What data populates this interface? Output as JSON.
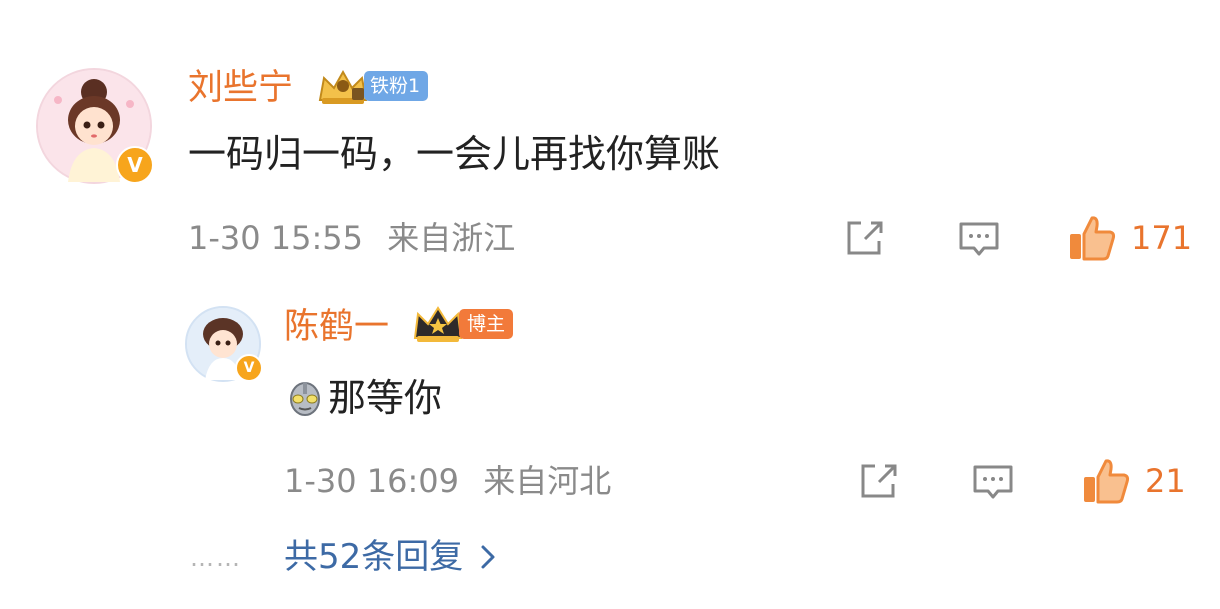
{
  "comment": {
    "username": "刘些宁",
    "fan_badge": {
      "label": "铁粉1",
      "icon": "crown-fan-icon"
    },
    "text": "一码归一码，一会儿再找你算账",
    "timestamp": "1-30 15:55",
    "location": "来自浙江",
    "likes": "171",
    "avatar_badge": "V"
  },
  "reply": {
    "username": "陈鹤一",
    "role_badge": {
      "label": "博主",
      "icon": "crown-star-icon"
    },
    "emoji": "ultraman-emoji-icon",
    "text": "那等你",
    "timestamp": "1-30 16:09",
    "location": "来自河北",
    "likes": "21",
    "avatar_badge": "V"
  },
  "more_replies": {
    "dots": "……",
    "label": "共52条回复",
    "arrow": "chevron-right-icon"
  },
  "colors": {
    "username": "#e9742d",
    "text": "#222222",
    "meta": "#8a8a8a",
    "link": "#3d6aa5",
    "fan_badge": "#6fa7e6",
    "blogger_badge": "#f27a3a",
    "like_icon": "#f08a3c"
  }
}
